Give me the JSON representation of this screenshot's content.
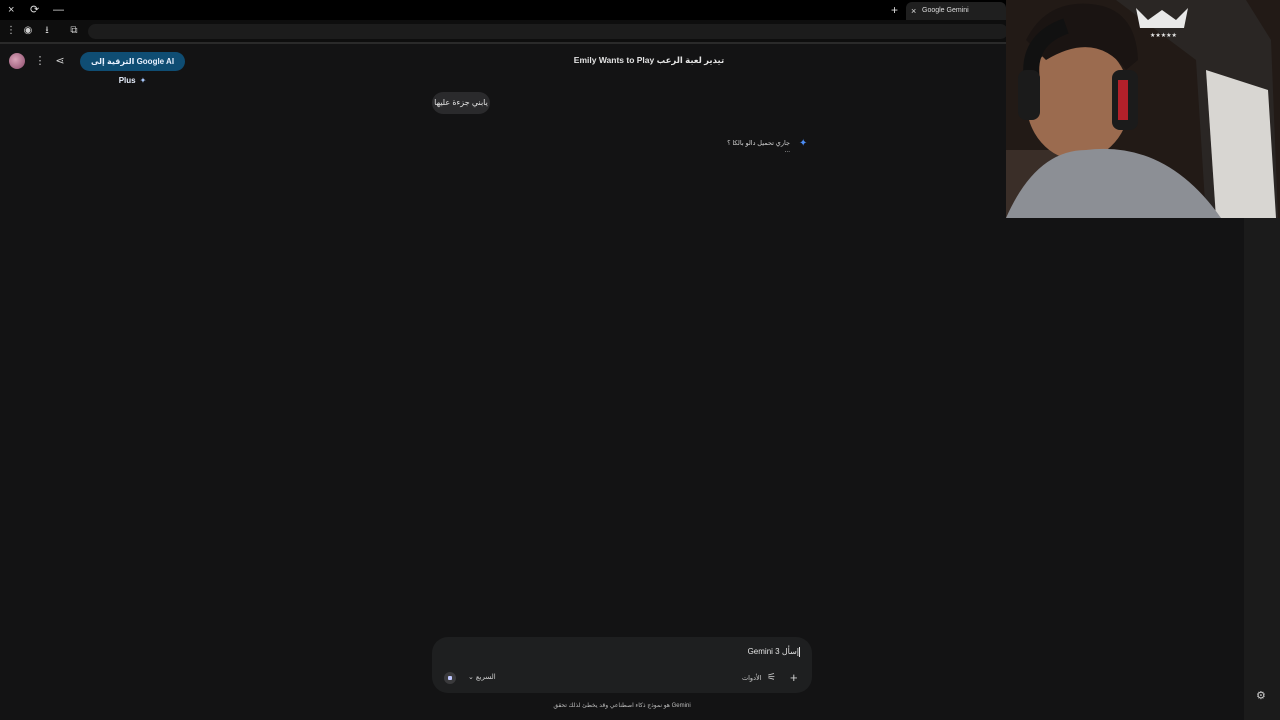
{
  "browser": {
    "tab_title": "Google Gemini",
    "tab_close": "×",
    "new_tab": "+",
    "window_close": "×",
    "window_min": "—",
    "window_reload": "⟳"
  },
  "header": {
    "title": "تيدير لعبة الرعب Emily Wants to Play",
    "upgrade_label": "الترقية إلى Google AI Plus",
    "upgrade_icon": "sparkle-icon"
  },
  "conversation": {
    "user_message": "يابني جزءة عليها",
    "assistant_reply": "جاري تحميل دالو بالكا ؟ ..."
  },
  "composer": {
    "placeholder": "إسأل Gemini 3",
    "model": "السريع",
    "tools": "الأدوات",
    "stop": "stop-icon"
  },
  "footer": {
    "disclaimer": "Gemini هو نموذج ذكاء اصطناعي وقد يخطئ لذلك تحقق"
  },
  "colors": {
    "background": "#131314",
    "upgrade": "#0f4d73",
    "accent": "#4c8df6"
  }
}
